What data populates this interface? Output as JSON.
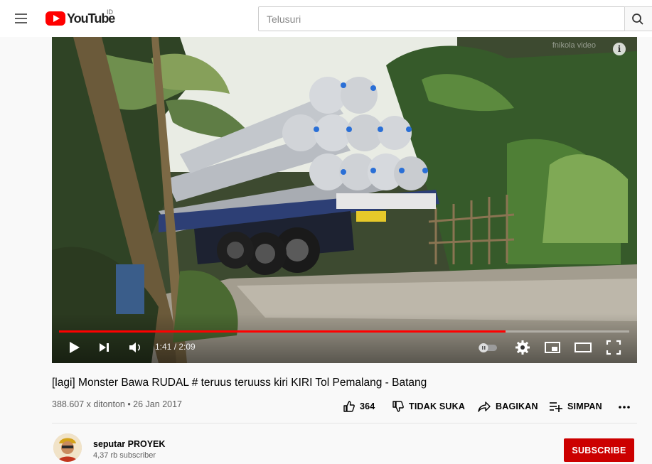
{
  "header": {
    "logo_text": "YouTube",
    "region": "ID",
    "search_placeholder": "Telusuri"
  },
  "player": {
    "watermark": "fnikola video",
    "current_time": "1:41",
    "duration": "2:09",
    "time_display": "1:41 / 2:09",
    "progress_fraction": 0.783,
    "accent_color": "#ff0000"
  },
  "video": {
    "title": "[lagi] Monster Bawa RUDAL # teruus teruuss kiri KIRI Tol Pemalang - Batang",
    "meta": "388.607 x ditonton • 26 Jan 2017",
    "like_count": "364",
    "dislike_label": "TIDAK SUKA",
    "share_label": "BAGIKAN",
    "save_label": "SIMPAN"
  },
  "channel": {
    "name": "seputar PROYEK",
    "subscribers": "4,37 rb subscriber",
    "subscribe_label": "SUBSCRIBE",
    "subscribe_color": "#cc0000"
  },
  "icons": [
    "menu-icon",
    "youtube-logo",
    "search-icon",
    "info-icon",
    "play-icon",
    "next-icon",
    "volume-icon",
    "autoplay-toggle",
    "settings-gear-icon",
    "miniplayer-icon",
    "theater-mode-icon",
    "fullscreen-icon",
    "thumbs-up-icon",
    "thumbs-down-icon",
    "share-icon",
    "add-to-playlist-icon",
    "more-icon"
  ]
}
